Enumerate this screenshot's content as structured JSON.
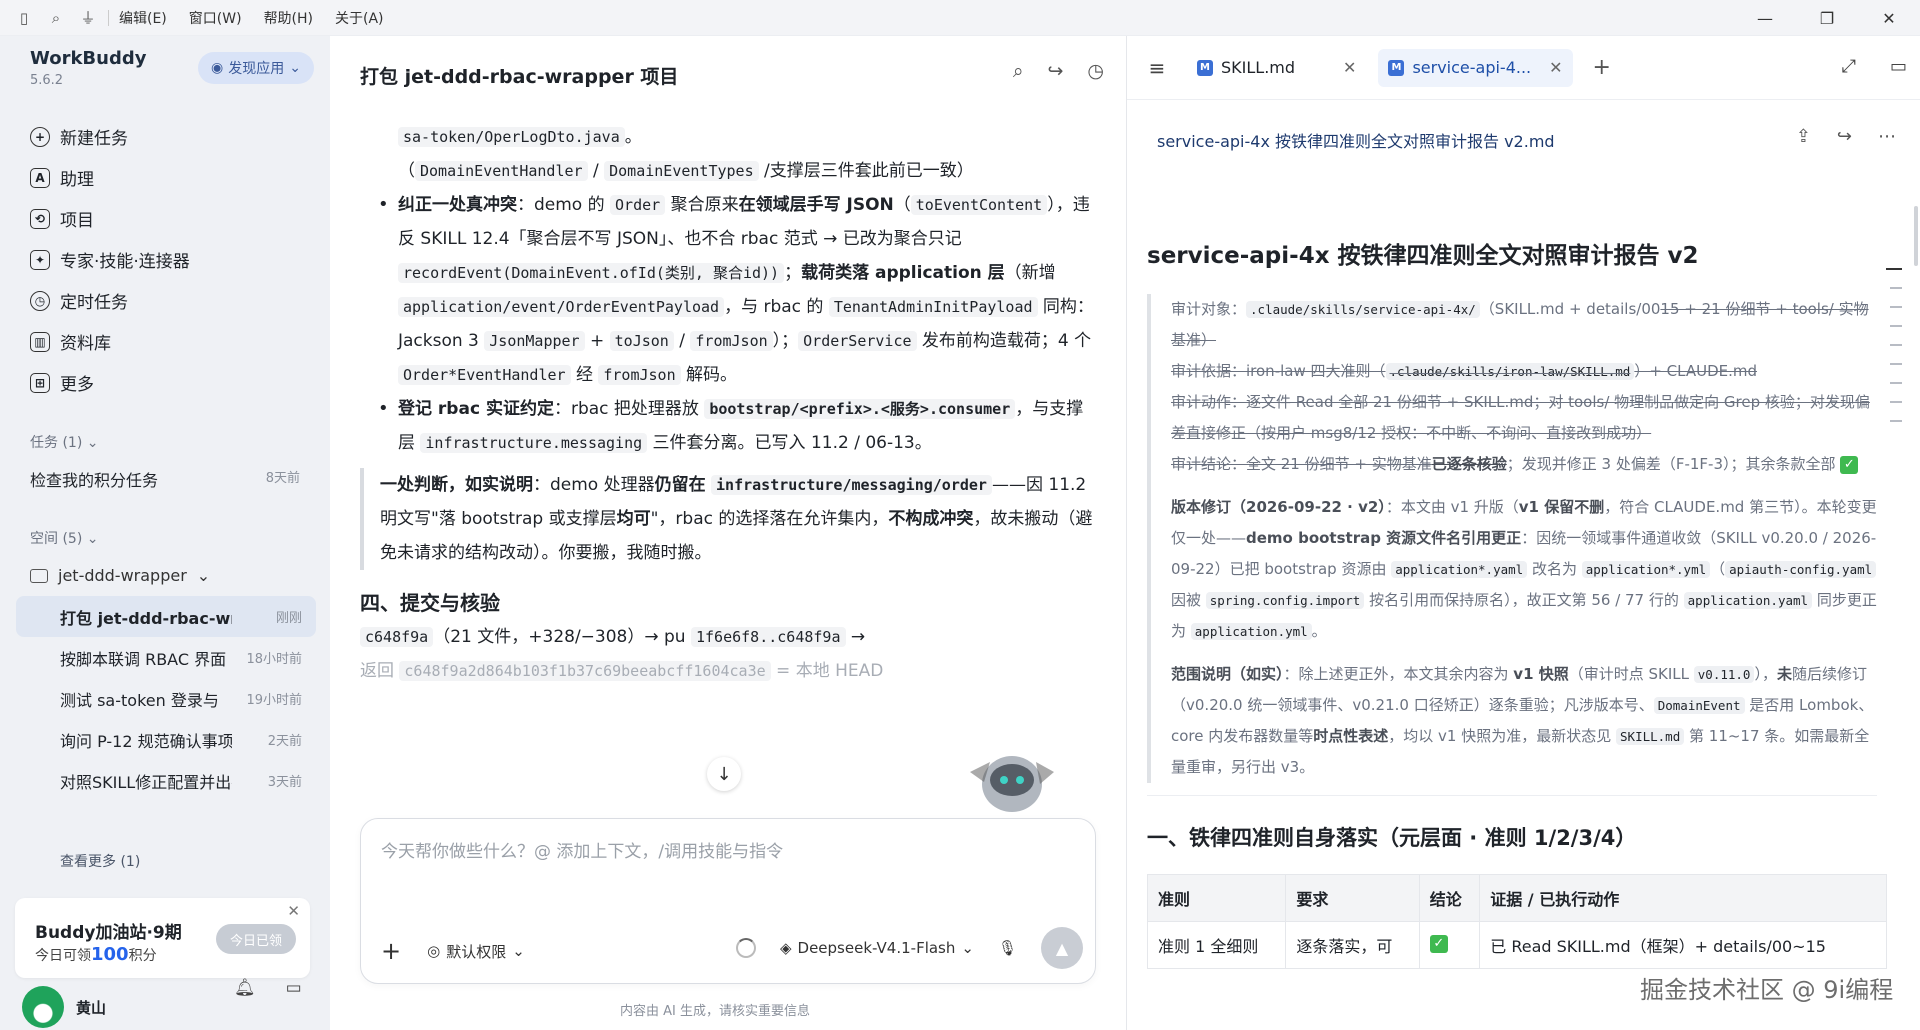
{
  "menu": [
    "编辑(E)",
    "窗口(W)",
    "帮助(H)",
    "关于(A)"
  ],
  "sidebar": {
    "brand": "WorkBuddy",
    "version": "5.6.2",
    "discover": "发现应用",
    "nav": [
      "新建任务",
      "助理",
      "项目",
      "专家·技能·连接器",
      "定时任务",
      "资料库",
      "更多"
    ],
    "tasks_header": "任务 (1)",
    "task": {
      "name": "检查我的积分任务",
      "time": "8天前"
    },
    "spaces_header": "空间 (5)",
    "folder": "jet-ddd-wrapper",
    "conversations": [
      {
        "name": "打包 jet-ddd-rbac-wrapper 项目",
        "time": "刚刚"
      },
      {
        "name": "按脚本联调 RBAC 界面",
        "time": "18小时前"
      },
      {
        "name": "测试 sa-token 登录与",
        "time": "19小时前"
      },
      {
        "name": "询问 P-12 规范确认事项",
        "time": "2天前"
      },
      {
        "name": "对照SKILL修正配置并出报告",
        "time": "3天前"
      }
    ],
    "see_more": "查看更多 (1)",
    "promo": {
      "title": "Buddy加油站·9期",
      "sub_prefix": "今日可领",
      "points": "100",
      "sub_suffix": "积分",
      "button": "今日已领"
    },
    "user": "黄山"
  },
  "chat": {
    "title": "打包 jet-ddd-rbac-wrapper 项目",
    "l1": "sa-token/OperLogDto.java",
    "l1b": "。",
    "l2a": "（",
    "l2b": "DomainEventHandler",
    "l2c": " / ",
    "l2d": "DomainEventTypes",
    "l2e": " /支撑层三件套此前已一致）",
    "b1_title": "纠正一处真冲突",
    "b1_a": "：demo 的 ",
    "b1_code1": "Order",
    "b1_b": " 聚合原来",
    "b1_bold": "在领域层手写 JSON",
    "b1_c": "（",
    "b1_code2": "toEventContent",
    "b1_d": "），违反 SKILL 12.4「聚合层不写 JSON」、也不合 rbac 范式 → 已改为聚合只记 ",
    "b1_code3": "recordEvent(DomainEvent.ofId(类别, 聚合id))",
    "b1_e": "；",
    "b1_bold2": "载荷类落 application 层",
    "b1_f": "（新增 ",
    "b1_code4": "application/event/OrderEventPayload",
    "b1_g": "，与 rbac 的 ",
    "b1_code5": "TenantAdminInitPayload",
    "b1_h": " 同构：Jackson 3 ",
    "b1_code6": "JsonMapper",
    "b1_i": " + ",
    "b1_code7": "toJson",
    "b1_j": " / ",
    "b1_code8": "fromJson",
    "b1_k": "）；",
    "b1_code9": "OrderService",
    "b1_l": " 发布前构造载荷；4 个 ",
    "b1_code10": "Order*EventHandler",
    "b1_m": " 经 ",
    "b1_code11": "fromJson",
    "b1_n": " 解码。",
    "b2_title": "登记 rbac 实证约定",
    "b2_a": "：rbac 把处理器放 ",
    "b2_code1": "bootstrap/<prefix>.<服务>.consumer",
    "b2_b": "，与支撑层 ",
    "b2_code2": "infrastructure.messaging",
    "b2_c": " 三件套分离。已写入 11.2 / 06-13。",
    "q_bold1": "一处判断，如实说明",
    "q_a": "：demo 处理器",
    "q_bold2": "仍留在",
    "q_code": "infrastructure/messaging/order",
    "q_b": "——因 11.2 明文写\"落 bootstrap 或支撑层",
    "q_bold3": "均可",
    "q_c": "\"，rbac 的选择落在允许集内，",
    "q_bold4": "不构成冲突",
    "q_d": "，故未搬动（避免未请求的结构改动）。你要搬，我随时搬。",
    "h4": "四、提交与核验",
    "commit_code": "c648f9a",
    "commit_a": "（21 文件，+328/−308）→ pu",
    "commit_code2": "1f6e6f8..c648f9a",
    "commit_b": " →",
    "ret_a": "返回 ",
    "ret_code": "c648f9a2d864b103f1b37c69beeabcff1604ca3e",
    "ret_b": " = 本地 HEAD",
    "input_placeholder": "今天帮你做些什么？@ 添加上下文，/调用技能与指令",
    "permission": "默认权限",
    "model": "Deepseek-V4.1-Flash",
    "disclaimer": "内容由 AI 生成，请核实重要信息"
  },
  "doc": {
    "tabs": [
      "SKILL.md",
      "service-api-4..."
    ],
    "path": "service-api-4x 按铁律四准则全文对照审计报告 v2.md",
    "title": "service-api-4x 按铁律四准则全文对照审计报告 v2",
    "p1_a": "审计对象：",
    "p1_code": ".claude/skills/service-api-4x/",
    "p1_b": "（SKILL.md + details/00",
    "p1_strike": "15 + 21 份细节 + tools/ 实物基准）",
    "p2_strike": "审计依据：iron-law 四大准则（",
    "p2_code": ".claude/skills/iron-law/SKILL.md",
    "p2_strike2": "）+ CLAUDE.md",
    "p3_strike": "审计动作：逐文件 Read 全部 21 份细节 + SKILL.md；对 tools/ 物理制品做定向 Grep 核验；对发现偏差直接修正（按用户 msg8/12 授权：不中断、不询问、直接改到成功）",
    "p4_strike": "审计结论：全文 21 份细节 + 实物基准",
    "p4_bold": "已逐条核验",
    "p4_b": "；发现并修正 3 处偏差（F-1F-3）；其余条款全部",
    "p5_bold": "版本修订（2026-09-22 · v2）",
    "p5_a": "：本文由 v1 升版（",
    "p5_bold2": "v1 保留不删",
    "p5_b": "，符合 CLAUDE.md 第三节）。本轮变更仅一处——",
    "p5_bold3": "demo bootstrap 资源文件名引用更正",
    "p5_c": "：因统一领域事件通道收敛（SKILL v0.20.0 / 2026-09-22）已把 bootstrap 资源由 ",
    "p5_code1": "application*.yaml",
    "p5_d": " 改名为 ",
    "p5_code2": "application*.yml",
    "p5_e": "（",
    "p5_code3": "apiauth-config.yaml",
    "p5_f": " 因被 ",
    "p5_code4": "spring.config.import",
    "p5_g": " 按名引用而保持原名），故正文第 56 / 77 行的 ",
    "p5_code5": "application.yaml",
    "p5_h": " 同步更正为 ",
    "p5_code6": "application.yml",
    "p5_i": "。",
    "p6_bold": "范围说明（如实）",
    "p6_a": "：除上述更正外，本文其余内容为 ",
    "p6_bold2": "v1 快照",
    "p6_b": "（审计时点 SKILL ",
    "p6_code1": "v0.11.0",
    "p6_c": "），",
    "p6_bold3": "未",
    "p6_d": "随后续修订（v0.20.0 统一领域事件、v0.21.0 口径矫正）逐条重验；凡涉版本号、",
    "p6_code2": "DomainEvent",
    "p6_e": " 是否用 Lombok、core 内发布器数量等",
    "p6_bold4": "时点性表述",
    "p6_f": "，均以 v1 快照为准，最新状态见 ",
    "p6_code3": "SKILL.md",
    "p6_g": " 第 11~17 条。如需最新全量重审，另行出 v3。",
    "h2": "一、铁律四准则自身落实（元层面 · 准则 1/2/3/4）",
    "table_headers": [
      "准则",
      "要求",
      "结论",
      "证据 / 已执行动作"
    ],
    "row1": [
      "准则 1 全细则",
      "逐条落实，可",
      "",
      "已 Read SKILL.md（框架）+ details/00~15"
    ]
  },
  "watermark": "掘金技术社区 @ 9i编程"
}
